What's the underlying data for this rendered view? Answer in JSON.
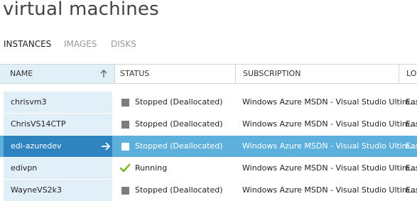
{
  "page": {
    "title": "virtual machines"
  },
  "tabs": [
    {
      "label": "INSTANCES",
      "active": true
    },
    {
      "label": "IMAGES",
      "active": false
    },
    {
      "label": "DISKS",
      "active": false
    }
  ],
  "table": {
    "columns": {
      "name": "NAME",
      "status": "STATUS",
      "subscription": "SUBSCRIPTION",
      "location": "LO"
    },
    "rows": [
      {
        "name": "chrisvm3",
        "status": "Stopped (Deallocated)",
        "status_icon": "stopped-square-icon",
        "subscription": "Windows Azure MSDN - Visual Studio Ultim...",
        "location": "Eas"
      },
      {
        "name": "ChrisVS14CTP",
        "status": "Stopped (Deallocated)",
        "status_icon": "stopped-square-icon",
        "subscription": "Windows Azure MSDN - Visual Studio Ultim...",
        "location": "Eas"
      },
      {
        "name": "edi-azuredev",
        "status": "Stopped (Deallocated)",
        "status_icon": "stopped-square-icon",
        "subscription": "Windows Azure MSDN - Visual Studio Ultim...",
        "location": "Eas",
        "selected": true
      },
      {
        "name": "edivpn",
        "status": "Running",
        "status_icon": "running-check-icon",
        "subscription": "Windows Azure MSDN - Visual Studio Ultim...",
        "location": "Eas"
      },
      {
        "name": "WayneVS2k3",
        "status": "Stopped (Deallocated)",
        "status_icon": "stopped-square-icon",
        "subscription": "Windows Azure MSDN - Visual Studio Ultim...",
        "location": "Eas"
      }
    ]
  },
  "colors": {
    "selected_row": "#5db0dc",
    "selected_name_cell": "#2d84bf",
    "name_column_bg": "#e1eff8",
    "running_check": "#7ab929",
    "stopped_square": "#7c7c7c"
  }
}
